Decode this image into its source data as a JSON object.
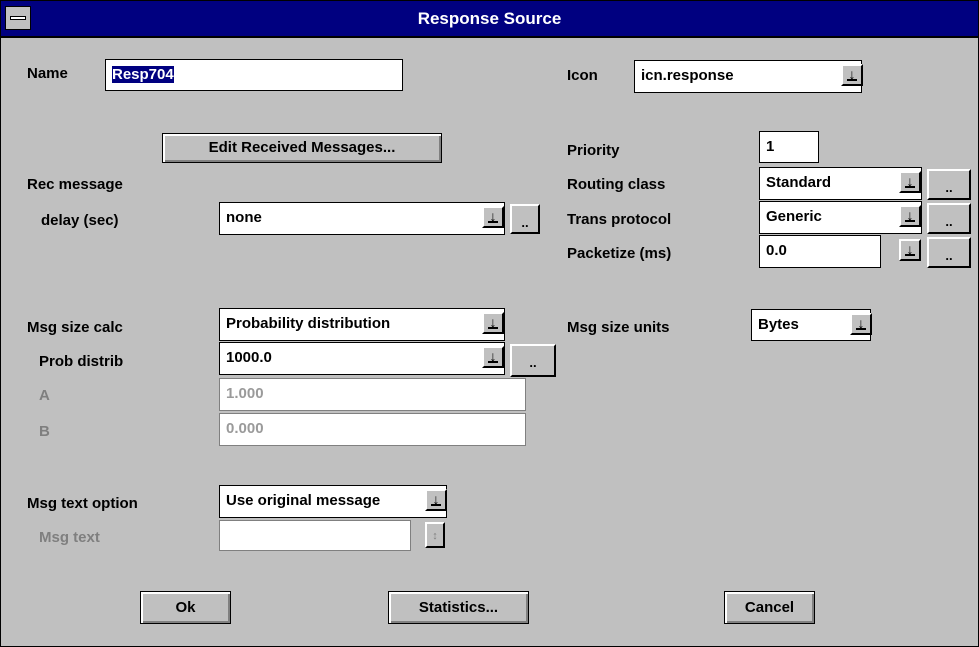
{
  "window": {
    "title": "Response Source"
  },
  "name": {
    "label": "Name",
    "value": "Resp704"
  },
  "icon": {
    "label": "Icon",
    "value": "icn.response"
  },
  "edit_received_button": "Edit Received Messages...",
  "priority": {
    "label": "Priority",
    "value": "1"
  },
  "rec_message": {
    "label_line1": "Rec message",
    "label_line2": "delay (sec)",
    "value": "none",
    "more": ".."
  },
  "routing_class": {
    "label": "Routing class",
    "value": "Standard",
    "more": ".."
  },
  "trans_protocol": {
    "label": "Trans protocol",
    "value": "Generic",
    "more": ".."
  },
  "packetize": {
    "label": "Packetize (ms)",
    "value": "0.0",
    "more": ".."
  },
  "msg_size_calc": {
    "label": "Msg size calc",
    "value": "Probability distribution"
  },
  "msg_size_units": {
    "label": "Msg size units",
    "value": "Bytes"
  },
  "prob_distrib": {
    "label": "Prob distrib",
    "value": "1000.0",
    "more": ".."
  },
  "param_a": {
    "label": "A",
    "value": "1.000"
  },
  "param_b": {
    "label": "B",
    "value": "0.000"
  },
  "msg_text_option": {
    "label": "Msg text option",
    "value": "Use original message"
  },
  "msg_text": {
    "label": "Msg text",
    "value": ""
  },
  "buttons": {
    "ok": "Ok",
    "statistics": "Statistics...",
    "cancel": "Cancel"
  },
  "colors": {
    "titlebar": "#000080",
    "dialog_bg": "#c0c0c0",
    "disabled_text": "#7f7f7f"
  },
  "icons": {
    "dropdown": "arrow-down-underline",
    "system_menu": "minus-bar",
    "spin": "up-down-arrows"
  }
}
